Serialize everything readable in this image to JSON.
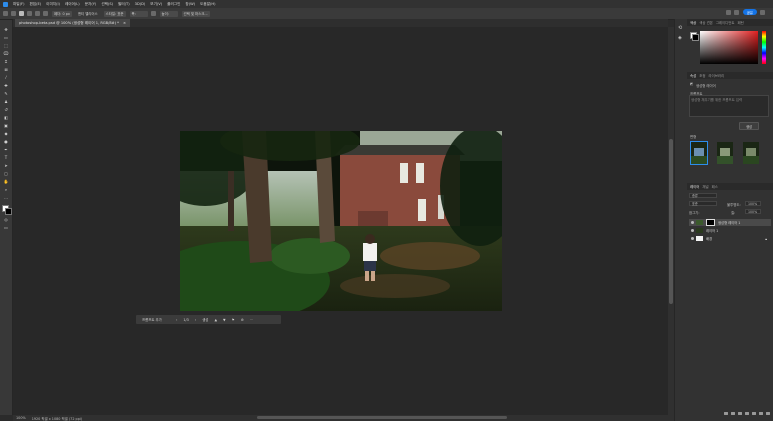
{
  "menubar": {
    "items": [
      "파일(F)",
      "편집(E)",
      "이미지(I)",
      "레이어(L)",
      "문자(Y)",
      "선택(S)",
      "필터(T)",
      "3D(D)",
      "보기(V)",
      "플러그인",
      "창(W)",
      "도움말(H)"
    ]
  },
  "optbar": {
    "mode_label": "모드:",
    "mode_value": "새 선택",
    "feather_label": "페더:",
    "feather_value": "0 px",
    "antialias_label": "앤티 앨리어스",
    "style_label": "스타일:",
    "style_value": "표준",
    "width_label": "폭:",
    "height_label": "높이:",
    "mask_button": "선택 및 마스크...",
    "share_label": "공유"
  },
  "document": {
    "tab_title": "photoshop-beta.psd @ 100% (생성형 레이어 1, RGB/8#) *",
    "zoom": "100%",
    "size_info": "1920 픽셀 x 1080 픽셀 (72 ppi)"
  },
  "context_bar": {
    "prompt_placeholder": "프롬프트 추가",
    "counter": "1/3",
    "generate_label": "생성"
  },
  "panels": {
    "color_tabs": [
      "색상",
      "색상 견본",
      "그레이디언트",
      "패턴"
    ],
    "properties_tabs": [
      "속성",
      "조정",
      "라이브러리"
    ],
    "gen_layer_label": "생성형 레이어",
    "prompt_section": "프롬프트",
    "prompt_hint": "생성형 채우기를 위한 프롬프트 입력",
    "generate_button": "생성",
    "variations_label": "변형",
    "layers_tabs": [
      "레이어",
      "채널",
      "패스"
    ],
    "kind_label": "종류",
    "blend_mode": "표준",
    "opacity_label": "불투명도:",
    "opacity_value": "100%",
    "lock_label": "잠그기:",
    "fill_label": "칠:",
    "fill_value": "100%",
    "layers": [
      {
        "name": "생성형 레이어 1",
        "selected": true
      },
      {
        "name": "레이어 1",
        "selected": false
      },
      {
        "name": "배경",
        "selected": false
      }
    ]
  },
  "colors": {
    "accent": "#1473e6",
    "selection": "#2d8ceb"
  }
}
